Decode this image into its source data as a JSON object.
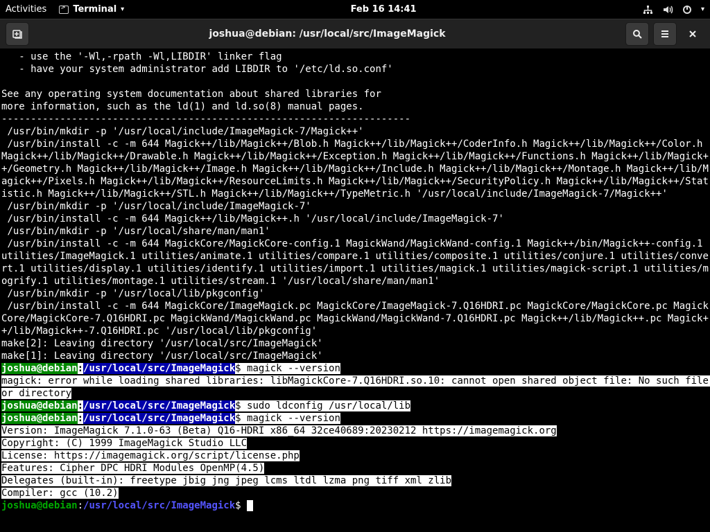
{
  "topbar": {
    "activities": "Activities",
    "app": "Terminal",
    "datetime": "Feb 16  14:41"
  },
  "window": {
    "title": "joshua@debian: /usr/local/src/ImageMagick"
  },
  "prompt": {
    "user": "joshua@debian",
    "path": "/usr/local/src/ImageMagick",
    "dollar": "$"
  },
  "lines": {
    "pre_a": "   - use the '-Wl,-rpath -Wl,LIBDIR' linker flag\n   - have your system administrator add LIBDIR to '/etc/ld.so.conf'\n\nSee any operating system documentation about shared libraries for\nmore information, such as the ld(1) and ld.so(8) manual pages.\n----------------------------------------------------------------------\n /usr/bin/mkdir -p '/usr/local/include/ImageMagick-7/Magick++'\n /usr/bin/install -c -m 644 Magick++/lib/Magick++/Blob.h Magick++/lib/Magick++/CoderInfo.h Magick++/lib/Magick++/Color.h Magick++/lib/Magick++/Drawable.h Magick++/lib/Magick++/Exception.h Magick++/lib/Magick++/Functions.h Magick++/lib/Magick++/Geometry.h Magick++/lib/Magick++/Image.h Magick++/lib/Magick++/Include.h Magick++/lib/Magick++/Montage.h Magick++/lib/Magick++/Pixels.h Magick++/lib/Magick++/ResourceLimits.h Magick++/lib/Magick++/SecurityPolicy.h Magick++/lib/Magick++/Statistic.h Magick++/lib/Magick++/STL.h Magick++/lib/Magick++/TypeMetric.h '/usr/local/include/ImageMagick-7/Magick++'\n /usr/bin/mkdir -p '/usr/local/include/ImageMagick-7'\n /usr/bin/install -c -m 644 Magick++/lib/Magick++.h '/usr/local/include/ImageMagick-7'\n /usr/bin/mkdir -p '/usr/local/share/man/man1'\n /usr/bin/install -c -m 644 MagickCore/MagickCore-config.1 MagickWand/MagickWand-config.1 Magick++/bin/Magick++-config.1 utilities/ImageMagick.1 utilities/animate.1 utilities/compare.1 utilities/composite.1 utilities/conjure.1 utilities/convert.1 utilities/display.1 utilities/identify.1 utilities/import.1 utilities/magick.1 utilities/magick-script.1 utilities/mogrify.1 utilities/montage.1 utilities/stream.1 '/usr/local/share/man/man1'\n /usr/bin/mkdir -p '/usr/local/lib/pkgconfig'\n /usr/bin/install -c -m 644 MagickCore/ImageMagick.pc MagickCore/ImageMagick-7.Q16HDRI.pc MagickCore/MagickCore.pc MagickCore/MagickCore-7.Q16HDRI.pc MagickWand/MagickWand.pc MagickWand/MagickWand-7.Q16HDRI.pc Magick++/lib/Magick++.pc Magick++/lib/Magick++-7.Q16HDRI.pc '/usr/local/lib/pkgconfig'\nmake[2]: Leaving directory '/usr/local/src/ImageMagick'\nmake[1]: Leaving directory '/usr/local/src/ImageMagick'",
    "cmd1": " magick --version",
    "err1": "magick: error while loading shared libraries: libMagickCore-7.Q16HDRI.so.10: cannot open shared object file: No such file or directory",
    "cmd2": " sudo ldconfig /usr/local/lib",
    "cmd3": " magick --version",
    "out3": "Version: ImageMagick 7.1.0-63 (Beta) Q16-HDRI x86_64 32ce40689:20230212 https://imagemagick.org\nCopyright: (C) 1999 ImageMagick Studio LLC\nLicense: https://imagemagick.org/script/license.php\nFeatures: Cipher DPC HDRI Modules OpenMP(4.5)\nDelegates (built-in): freetype jbig jng jpeg lcms ltdl lzma png tiff xml zlib\nCompiler: gcc (10.2)"
  }
}
